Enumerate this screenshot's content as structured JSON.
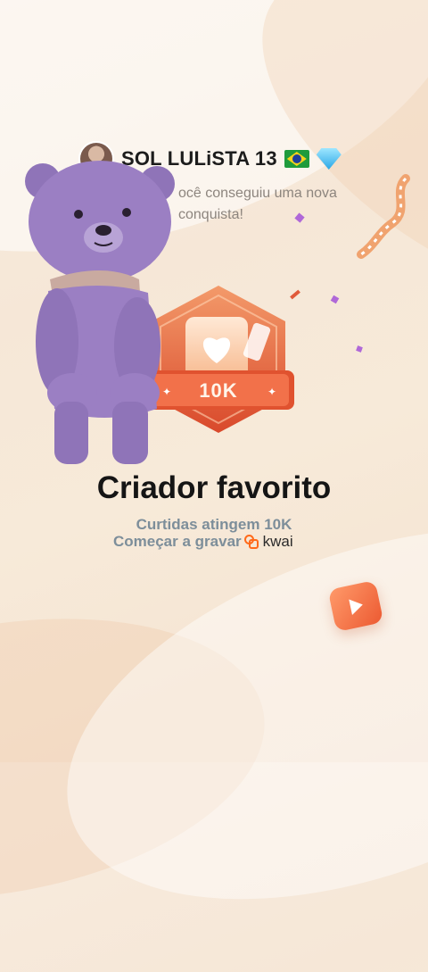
{
  "header": {
    "username": "SOL LULiSTA 13",
    "flag_icon": "brazil-flag-icon",
    "badge_icon": "diamond-icon"
  },
  "message": {
    "text": "ocê conseguiu uma nova conquista!"
  },
  "achievement": {
    "badge_label": "10K",
    "title": "Criador favorito",
    "subtitle": "Curtidas atingem 10K",
    "record_text": "Começar a gravar",
    "brand": "kwai"
  },
  "colors": {
    "accent": "#ec5a32",
    "bear": "#9b7fc3",
    "muted_text": "#7d8e9a"
  }
}
